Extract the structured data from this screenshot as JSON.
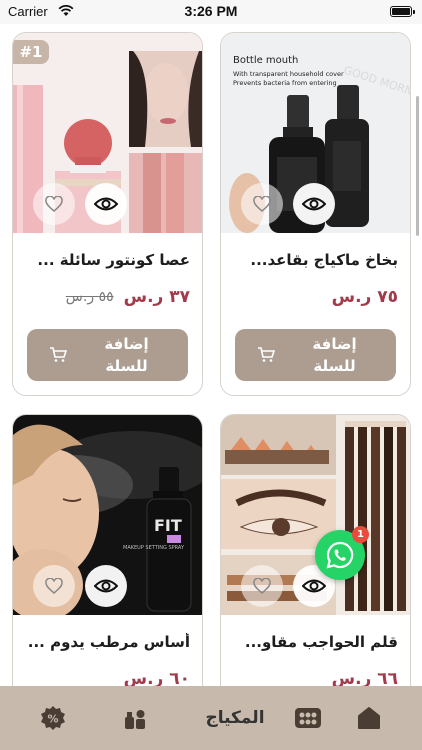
{
  "status_bar": {
    "carrier": "Carrier",
    "time": "3:26 PM"
  },
  "products": [
    {
      "title": "عصا كونتور سائلة ...",
      "price": "٣٧ ر.س",
      "old_price": "٥٥ ر.س",
      "rank": "#1",
      "add_label": "إضافة للسلة"
    },
    {
      "title": "بخاخ ماكياج بقاعد...",
      "price": "٧٥ ر.س",
      "add_label": "إضافة للسلة"
    },
    {
      "title": "أساس مرطب يدوم ...",
      "price": "٦٠ ر.س"
    },
    {
      "title": "قلم الحواجب مقاو...",
      "price": "٦٦ ر.س"
    }
  ],
  "photo_text": {
    "bottle_line1": "Bottle mouth",
    "bottle_line2": "With transparent household cover",
    "bottle_line3": "Prevents bacteria from entering",
    "morning": "GOOD MORNING",
    "fit_brand": "FIT",
    "setting_spray": "MAKEUP SETTING SPRAY"
  },
  "whatsapp": {
    "badge": "1"
  },
  "tab_bar": {
    "active_label": "المكياج"
  },
  "colors": {
    "accent": "#ac9d90",
    "price": "#a23a4c",
    "tab_bar": "#c7b9ab",
    "whatsapp": "#25d366"
  }
}
